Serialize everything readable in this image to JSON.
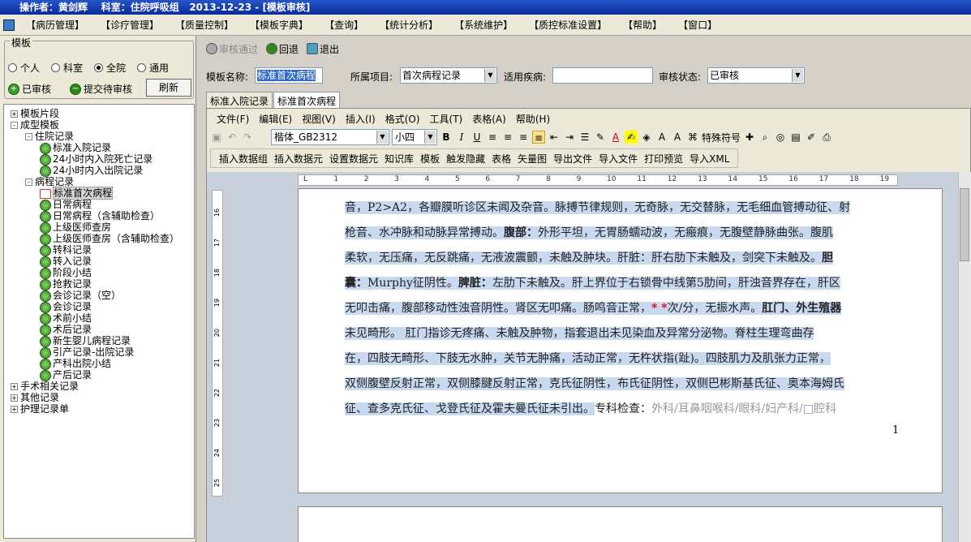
{
  "title": {
    "operator_label": "操作者：",
    "operator": "黄剑辉",
    "dept_label": "科室：",
    "dept": "住院呼吸组",
    "date": "2013-12-23",
    "window": "[模板审核]"
  },
  "menubar": [
    "【病历管理】",
    "【诊疗管理】",
    "【质量控制】",
    "【模板字典】",
    "【查询】",
    "【统计分析】",
    "【系统维护】",
    "【质控标准设置】",
    "【帮助】",
    "【窗口】"
  ],
  "left": {
    "group_title": "模板",
    "radios": [
      {
        "label": "个人",
        "checked": false
      },
      {
        "label": "科室",
        "checked": false
      },
      {
        "label": "全院",
        "checked": true
      },
      {
        "label": "通用",
        "checked": false
      }
    ],
    "approved_label": "已审核",
    "submit_label": "提交待审核",
    "refresh_label": "刷新",
    "tree": [
      {
        "label": "模板片段",
        "level": 0,
        "exp": "+"
      },
      {
        "label": "成型模板",
        "level": 0,
        "exp": "-"
      },
      {
        "label": "住院记录",
        "level": 1,
        "exp": "-"
      },
      {
        "label": "标准入院记录",
        "level": 2,
        "leaf": true
      },
      {
        "label": "24小时内入院死亡记录",
        "level": 2,
        "leaf": true
      },
      {
        "label": "24小时内入出院记录",
        "level": 2,
        "leaf": true
      },
      {
        "label": "病程记录",
        "level": 1,
        "exp": "-"
      },
      {
        "label": "标准首次病程",
        "level": 2,
        "selected": true
      },
      {
        "label": "日常病程",
        "level": 2,
        "leaf": true
      },
      {
        "label": "日常病程（含辅助检查）",
        "level": 2,
        "leaf": true
      },
      {
        "label": "上级医师查房",
        "level": 2,
        "leaf": true
      },
      {
        "label": "上级医师查房（含辅助检查）",
        "level": 2,
        "leaf": true
      },
      {
        "label": "转科记录",
        "level": 2,
        "leaf": true
      },
      {
        "label": "转入记录",
        "level": 2,
        "leaf": true
      },
      {
        "label": "阶段小结",
        "level": 2,
        "leaf": true
      },
      {
        "label": "抢救记录",
        "level": 2,
        "leaf": true
      },
      {
        "label": "会诊记录（空）",
        "level": 2,
        "leaf": true
      },
      {
        "label": "会诊记录",
        "level": 2,
        "leaf": true
      },
      {
        "label": "术前小结",
        "level": 2,
        "leaf": true
      },
      {
        "label": "术后记录",
        "level": 2,
        "leaf": true
      },
      {
        "label": "新生婴儿病程记录",
        "level": 2,
        "leaf": true
      },
      {
        "label": "引产记录-出院记录",
        "level": 2,
        "leaf": true
      },
      {
        "label": "产科出院小结",
        "level": 2,
        "leaf": true
      },
      {
        "label": "产后记录",
        "level": 2,
        "leaf": true
      },
      {
        "label": "手术相关记录",
        "level": 0,
        "exp": "+"
      },
      {
        "label": "其他记录",
        "level": 0,
        "exp": "+"
      },
      {
        "label": "护理记录单",
        "level": 0,
        "exp": "+"
      }
    ]
  },
  "toolbar": {
    "approve": "审核通过",
    "back": "回退",
    "exit": "退出"
  },
  "form": {
    "name_label": "模板名称:",
    "name_value": "标准首次病程",
    "item_label": "所属项目:",
    "item_value": "首次病程记录",
    "disease_label": "适用疾病:",
    "disease_value": "",
    "status_label": "审核状态:",
    "status_value": "已审核"
  },
  "tabs": [
    "标准入院记录",
    "标准首次病程"
  ],
  "editor": {
    "menu": [
      "文件(F)",
      "编辑(E)",
      "视图(V)",
      "插入(I)",
      "格式(O)",
      "工具(T)",
      "表格(A)",
      "帮助(H)"
    ],
    "font": "楷体_GB2312",
    "size": "小四",
    "special_chars": "特殊符号",
    "insert_bar": [
      "插入数据组",
      "插入数据元",
      "设置数据元",
      "知识库",
      "模板",
      "触发隐藏",
      "表格",
      "矢量图",
      "导出文件",
      "导入文件",
      "打印预览",
      "导入XML"
    ],
    "ruler_marks": [
      "L",
      "1",
      "2",
      "3",
      "4",
      "5",
      "6",
      "7",
      "8",
      "9",
      "10",
      "11",
      "12",
      "13",
      "14",
      "15",
      "16",
      "17",
      "18",
      "19"
    ],
    "vruler_marks": [
      "16",
      "17",
      "18",
      "19",
      "20",
      "21",
      "22",
      "23",
      "24",
      "25"
    ],
    "page_number": "1",
    "lines": [
      [
        {
          "t": "音，P2>A2，各瓣膜听诊区未闻及杂音。脉搏节律规则，无奇脉，无交替脉，无毛细血管搏动征、射"
        }
      ],
      [
        {
          "t": "枪音、水冲脉和动脉异常搏动。"
        },
        {
          "t": "腹部：",
          "b": true
        },
        {
          "t": "外形平坦，无胃肠蠕动波，无瘢痕，无腹壁静脉曲张。腹肌"
        }
      ],
      [
        {
          "t": "柔软，无压痛，无反跳痛，无液波震颤，未触及肿块。肝脏：肝右肋下未触及，剑突下未触及。"
        },
        {
          "t": "胆",
          "b": true
        }
      ],
      [
        {
          "t": "囊：",
          "b": true
        },
        {
          "t": "Murphy征阴性。"
        },
        {
          "t": "脾脏：",
          "b": true
        },
        {
          "t": "左肋下未触及。肝上界位于右锁骨中线第5肋间，肝浊音界存在，肝区"
        }
      ],
      [
        {
          "t": "无叩击痛，腹部移动性浊音阴性。肾区无叩痛。肠鸣音正常，"
        },
        {
          "t": "*  *",
          "red": true
        },
        {
          "t": "次/分，无振水声。"
        },
        {
          "t": "肛门、外生殖器",
          "b": true
        }
      ],
      [
        {
          "t": "未见畸形。 肛门指诊无疼痛、未触及肿物，指套退出未见染血及异常分泌物。脊柱生理弯曲存"
        }
      ],
      [
        {
          "t": "在，四肢无畸形、下肢无水肿，关节无肿痛，活动正常，无杵状指(趾)。四肢肌力及肌张力正常，"
        }
      ],
      [
        {
          "t": "双侧腹壁反射正常，双侧膝腱反射正常，克氏征阴性，布氏征阴性，双侧巴彬斯基氏征、奥本海姆氏"
        }
      ],
      [
        {
          "t": "征、查多克氏征、戈登氏征及霍夫曼氏征未引出。"
        },
        {
          "t": "专科检查：",
          "nosel": true
        },
        {
          "t": "外科/耳鼻咽喉科/眼科/妇产科/□腔科",
          "gray": true
        }
      ]
    ]
  }
}
